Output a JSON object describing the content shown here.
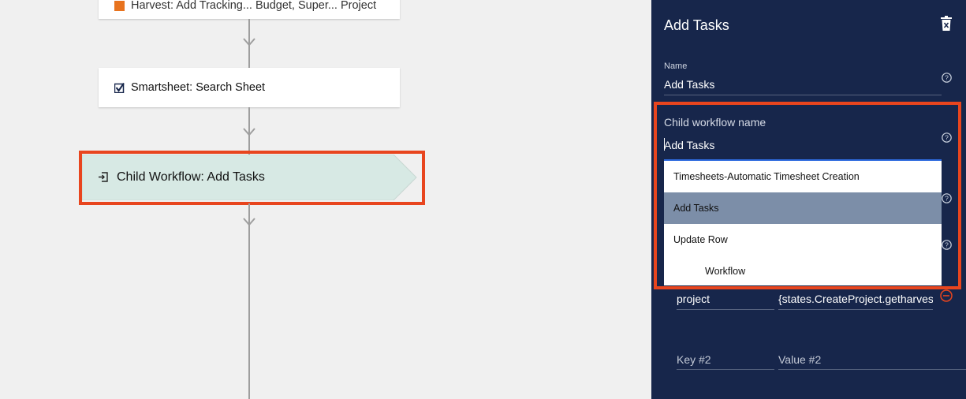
{
  "canvas": {
    "top_node_label": "Harvest: Add Tracking... Budget, Super... Project",
    "search_node_label": "Smartsheet: Search Sheet",
    "child_node_label": "Child Workflow: Add Tasks"
  },
  "panel": {
    "title": "Add Tasks",
    "name_label": "Name",
    "name_value": "Add Tasks",
    "child_workflow_label": "Child workflow name",
    "child_workflow_value": "Add Tasks",
    "dropdown_options": [
      "Timesheets-Automatic Timesheet Creation",
      "Add Tasks",
      "Update Row",
      "Workflow"
    ],
    "selected_option": "Add Tasks",
    "param_key": "project",
    "param_value": "{states.CreateProject.getharves",
    "key2_placeholder": "Key #2",
    "value2_placeholder": "Value #2"
  },
  "colors": {
    "panel_bg": "#17264b",
    "highlight": "#e8451e",
    "child_node_bg": "#d7e9e4",
    "selected_option_bg": "#7c8ea8",
    "focus_line": "#2e6bdf"
  },
  "icons": [
    "smartsheet-check-icon",
    "child-workflow-icon",
    "trash-icon",
    "help-icon",
    "remove-circle-icon"
  ]
}
